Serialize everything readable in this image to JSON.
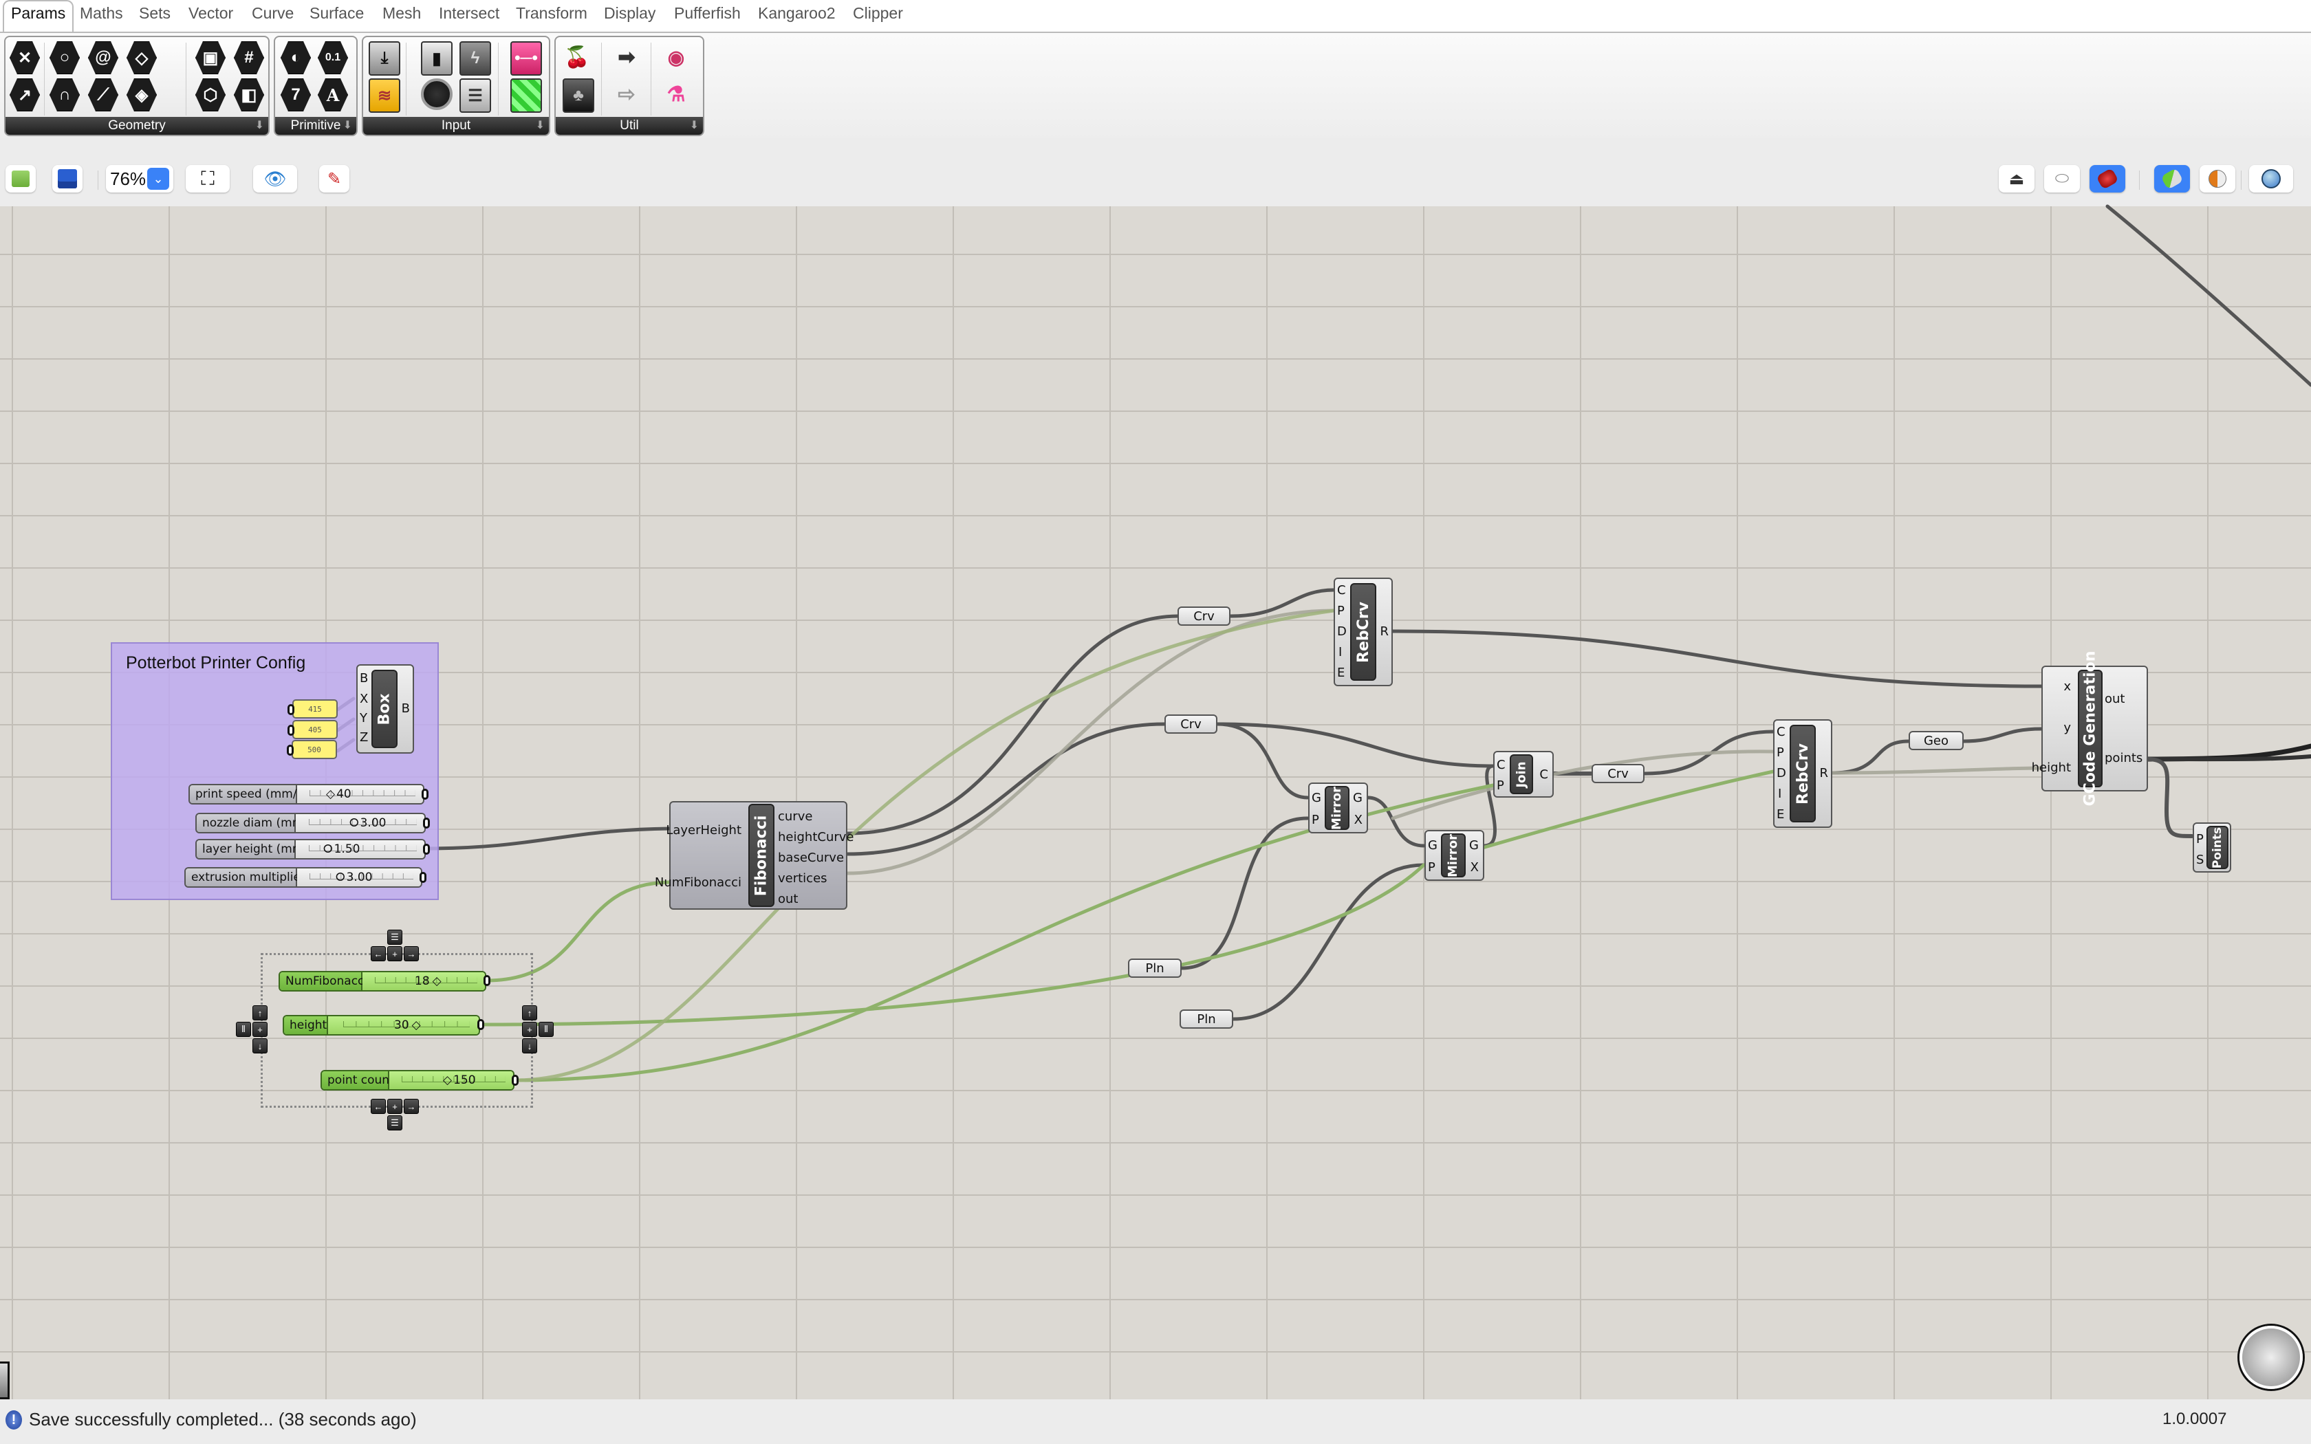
{
  "tabs": [
    "Params",
    "Maths",
    "Sets",
    "Vector",
    "Curve",
    "Surface",
    "Mesh",
    "Intersect",
    "Transform",
    "Display",
    "Pufferfish",
    "Kangaroo2",
    "Clipper"
  ],
  "active_tab": "Params",
  "ribbon": {
    "panels": [
      {
        "label": "Geometry",
        "icons": [
          "geometry-icon",
          "circle-icon",
          "curve-icon",
          "surface-icon",
          "box-icon",
          "mesh-icon",
          "vector-icon",
          "arc-icon",
          "line-icon",
          "brep-icon",
          "field-icon",
          "subd-icon"
        ]
      },
      {
        "label": "Primitive",
        "icons": [
          "boolean-icon",
          "number-icon",
          "integer-icon",
          "text-icon"
        ]
      },
      {
        "label": "Input",
        "icons": [
          "import-icon",
          "toggle-icon",
          "button-icon",
          "gradient-icon",
          "sketch-icon",
          "dial-icon",
          "value-list-icon",
          "colour-swatch-icon"
        ]
      },
      {
        "label": "Util",
        "icons": [
          "cherry-picker-icon",
          "relay-icon",
          "param-viewer-icon",
          "tree-icon",
          "hollow-arrow-icon",
          "flask-icon"
        ]
      }
    ],
    "glyphs": {
      "number": "0.1",
      "integer": "7",
      "text": "A"
    }
  },
  "toolbar": {
    "zoom": "76%",
    "buttons": [
      "open-file",
      "save-file",
      "zoom-extents",
      "preview",
      "sketch"
    ],
    "right_buttons": [
      "preview-off",
      "preview-wireframe",
      "preview-shaded",
      "preview-selected",
      "preview-mesh-quality",
      "document-preview-settings"
    ]
  },
  "canvas": {
    "group": {
      "title": "Potterbot Printer Config"
    },
    "box_component": {
      "name": "Box",
      "inputs": [
        "B",
        "X",
        "Y",
        "Z"
      ],
      "outputs": [
        "B"
      ]
    },
    "panels": [
      "415",
      "405",
      "500"
    ],
    "sliders": [
      {
        "label": "print speed (mm/s)",
        "value": "40",
        "knob": "diamond",
        "fraction": 0.4
      },
      {
        "label": "nozzle diam (mm)",
        "value": "3.00",
        "knob": "circle",
        "fraction": 0.5
      },
      {
        "label": "layer height (mm)",
        "value": "1.50",
        "knob": "circle",
        "fraction": 0.25
      },
      {
        "label": "extrusion multiplier",
        "value": "3.00",
        "knob": "circle",
        "fraction": 0.3
      }
    ],
    "green_sliders": [
      {
        "label": "NumFibonacci",
        "value": "18",
        "fraction": 0.45
      },
      {
        "label": "height",
        "value": "30",
        "fraction": 0.5
      },
      {
        "label": "point count",
        "value": "150",
        "fraction": 0.45
      }
    ],
    "fibonacci": {
      "name": "Fibonacci",
      "inputs": [
        "LayerHeight",
        "NumFibonacci"
      ],
      "outputs": [
        "curve",
        "heightCurve",
        "baseCurve",
        "vertices",
        "out"
      ]
    },
    "rebcrv": {
      "name": "RebCrv",
      "inputs": [
        "C",
        "P",
        "D",
        "I",
        "E"
      ],
      "outputs": [
        "R"
      ]
    },
    "mirror": {
      "name": "Mirror",
      "inputs": [
        "G",
        "P"
      ],
      "outputs": [
        "G",
        "X"
      ]
    },
    "join": {
      "name": "Join",
      "inputs": [
        "C",
        "P"
      ],
      "outputs": [
        "C"
      ]
    },
    "gcode": {
      "name": "GCode Generation",
      "inputs": [
        "x",
        "y",
        "height"
      ],
      "outputs": [
        "out",
        "points"
      ]
    },
    "points": {
      "name": "Points",
      "inputs": [
        "P",
        "S"
      ]
    },
    "params": {
      "crv": "Crv",
      "pln": "Pln",
      "geo": "Geo"
    }
  },
  "status": {
    "message": "Save successfully completed... (38 seconds ago)",
    "version": "1.0.0007"
  }
}
